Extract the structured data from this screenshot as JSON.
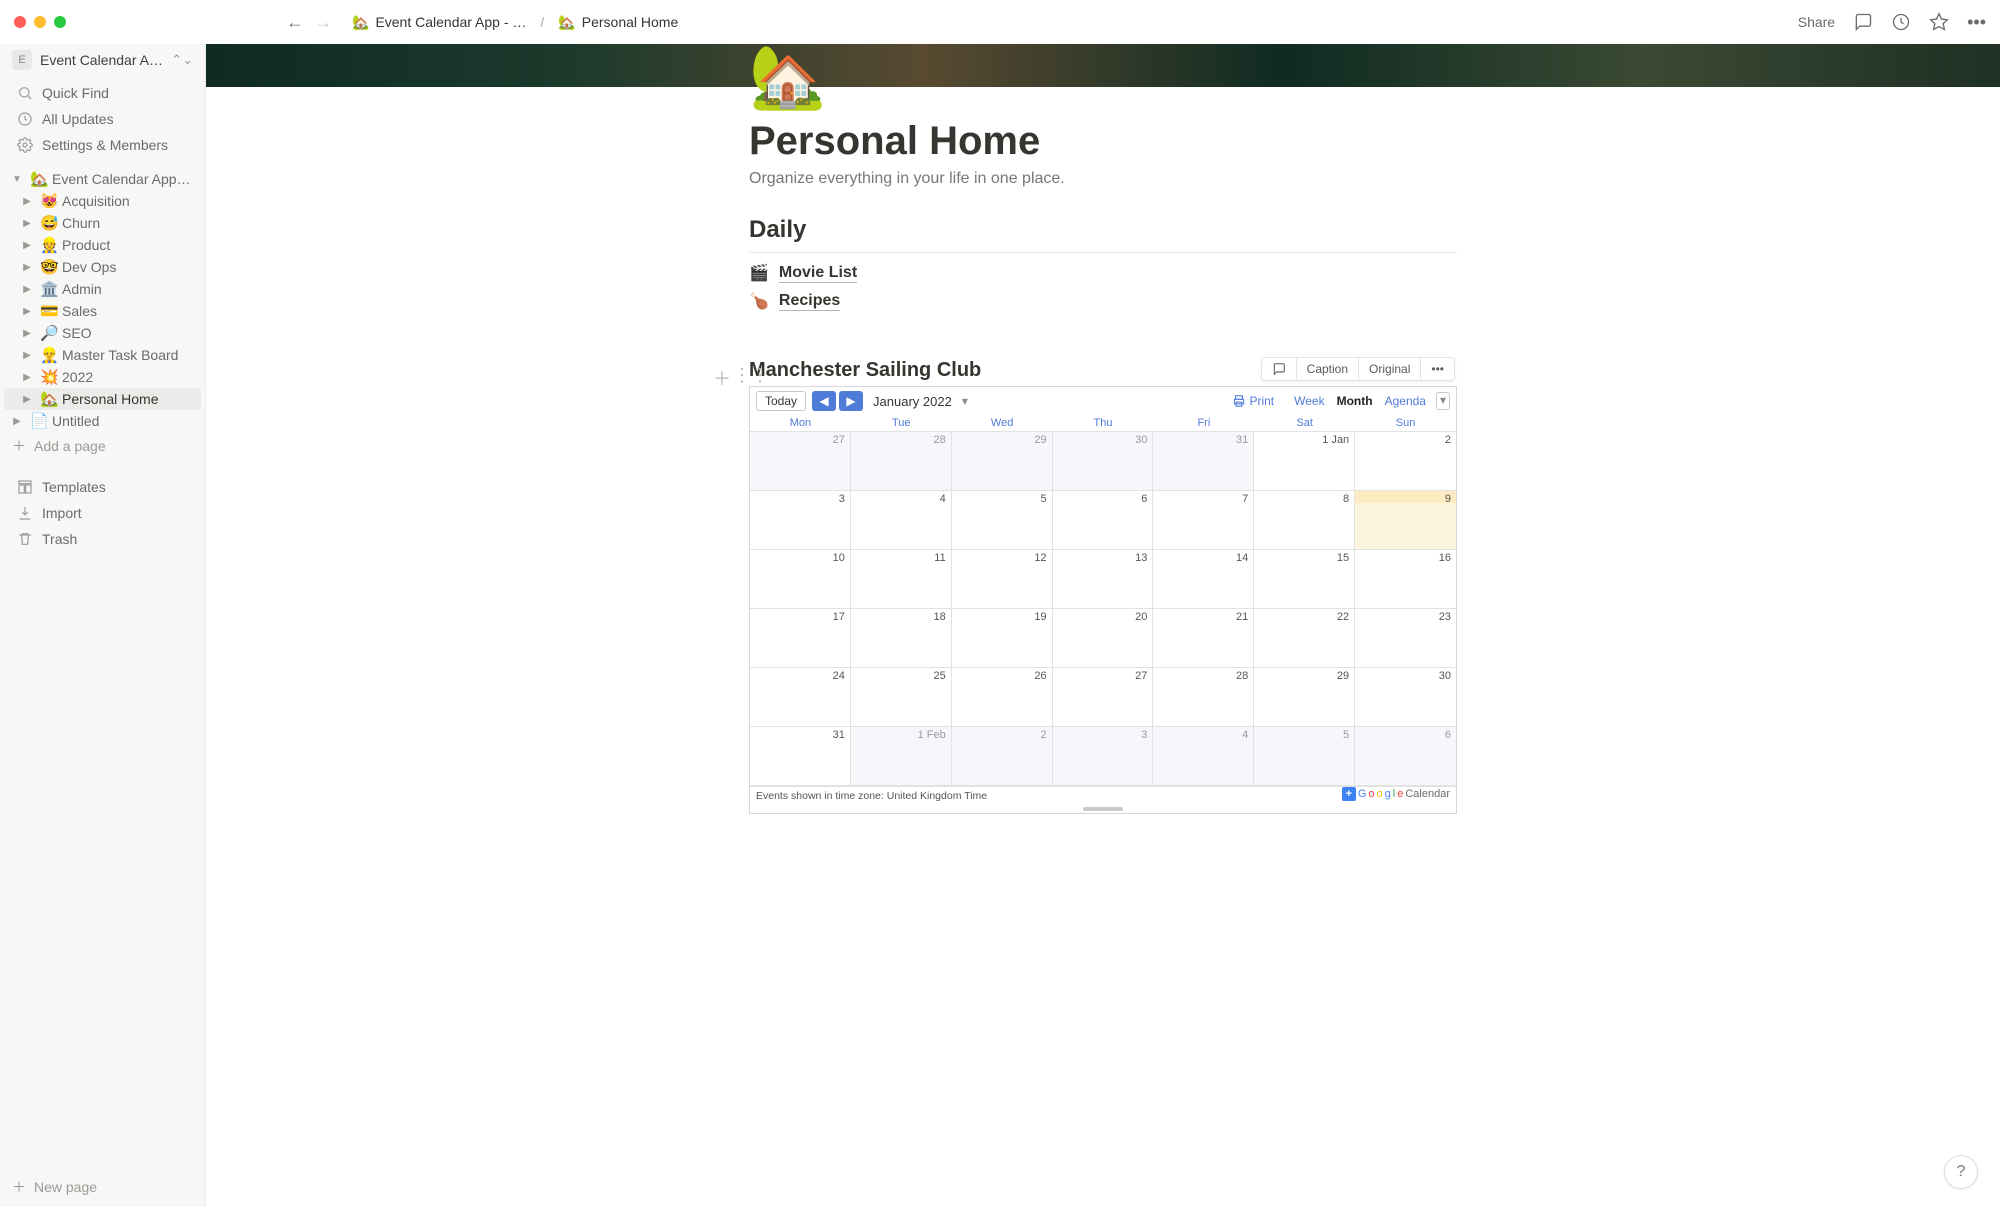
{
  "topbar": {
    "breadcrumb": [
      {
        "emoji": "🏡",
        "label": "Event Calendar App - …"
      },
      {
        "emoji": "🏡",
        "label": "Personal Home"
      }
    ],
    "share": "Share"
  },
  "sidebar": {
    "workspace_letter": "E",
    "workspace": "Event Calendar App",
    "nav": [
      {
        "icon": "search",
        "label": "Quick Find"
      },
      {
        "icon": "clock",
        "label": "All Updates"
      },
      {
        "icon": "gear",
        "label": "Settings & Members"
      }
    ],
    "tree_root": {
      "emoji": "🏡",
      "label": "Event Calendar App - …",
      "expanded": true
    },
    "tree_children": [
      {
        "emoji": "😻",
        "label": "Acquisition"
      },
      {
        "emoji": "😅",
        "label": "Churn"
      },
      {
        "emoji": "👷",
        "label": "Product"
      },
      {
        "emoji": "🤓",
        "label": "Dev Ops"
      },
      {
        "emoji": "🏛️",
        "label": "Admin"
      },
      {
        "emoji": "💳",
        "label": "Sales"
      },
      {
        "emoji": "🔎",
        "label": "SEO"
      },
      {
        "emoji": "👷‍♂️",
        "label": "Master Task Board"
      },
      {
        "emoji": "💥",
        "label": "2022"
      },
      {
        "emoji": "🏡",
        "label": "Personal Home",
        "active": true
      }
    ],
    "untitled": {
      "emoji": "📄",
      "label": "Untitled"
    },
    "add_page": "Add a page",
    "footer": [
      {
        "icon": "template",
        "label": "Templates"
      },
      {
        "icon": "import",
        "label": "Import"
      },
      {
        "icon": "trash",
        "label": "Trash"
      }
    ],
    "new_page": "New page"
  },
  "page": {
    "emoji": "🏡",
    "title": "Personal Home",
    "subtitle": "Organize everything in your life in one place.",
    "section": "Daily",
    "links": [
      {
        "emoji": "🎬",
        "label": "Movie List"
      },
      {
        "emoji": "🍗",
        "label": "Recipes"
      }
    ]
  },
  "embed": {
    "title": "Manchester Sailing Club",
    "toolbar": {
      "caption": "Caption",
      "original": "Original"
    },
    "today": "Today",
    "month_label": "January 2022",
    "print": "Print",
    "views": {
      "week": "Week",
      "month": "Month",
      "agenda": "Agenda"
    },
    "day_headers": [
      "Mon",
      "Tue",
      "Wed",
      "Thu",
      "Fri",
      "Sat",
      "Sun"
    ],
    "cells": [
      {
        "dn": "27",
        "cls": "out"
      },
      {
        "dn": "28",
        "cls": "out"
      },
      {
        "dn": "29",
        "cls": "out"
      },
      {
        "dn": "30",
        "cls": "out"
      },
      {
        "dn": "31",
        "cls": "out"
      },
      {
        "dn": "1 Jan",
        "cls": "cur"
      },
      {
        "dn": "2",
        "cls": "cur"
      },
      {
        "dn": "3",
        "cls": "cur"
      },
      {
        "dn": "4",
        "cls": "cur"
      },
      {
        "dn": "5",
        "cls": "cur"
      },
      {
        "dn": "6",
        "cls": "cur"
      },
      {
        "dn": "7",
        "cls": "cur"
      },
      {
        "dn": "8",
        "cls": "cur"
      },
      {
        "dn": "9",
        "cls": "today"
      },
      {
        "dn": "10",
        "cls": "cur"
      },
      {
        "dn": "11",
        "cls": "cur"
      },
      {
        "dn": "12",
        "cls": "cur"
      },
      {
        "dn": "13",
        "cls": "cur"
      },
      {
        "dn": "14",
        "cls": "cur"
      },
      {
        "dn": "15",
        "cls": "cur"
      },
      {
        "dn": "16",
        "cls": "cur"
      },
      {
        "dn": "17",
        "cls": "cur"
      },
      {
        "dn": "18",
        "cls": "cur"
      },
      {
        "dn": "19",
        "cls": "cur"
      },
      {
        "dn": "20",
        "cls": "cur"
      },
      {
        "dn": "21",
        "cls": "cur"
      },
      {
        "dn": "22",
        "cls": "cur"
      },
      {
        "dn": "23",
        "cls": "cur"
      },
      {
        "dn": "24",
        "cls": "cur"
      },
      {
        "dn": "25",
        "cls": "cur"
      },
      {
        "dn": "26",
        "cls": "cur"
      },
      {
        "dn": "27",
        "cls": "cur"
      },
      {
        "dn": "28",
        "cls": "cur"
      },
      {
        "dn": "29",
        "cls": "cur"
      },
      {
        "dn": "30",
        "cls": "cur"
      },
      {
        "dn": "31",
        "cls": "cur"
      },
      {
        "dn": "1 Feb",
        "cls": "out"
      },
      {
        "dn": "2",
        "cls": "out"
      },
      {
        "dn": "3",
        "cls": "out"
      },
      {
        "dn": "4",
        "cls": "out"
      },
      {
        "dn": "5",
        "cls": "out"
      },
      {
        "dn": "6",
        "cls": "out"
      }
    ],
    "tz": "Events shown in time zone: United Kingdom Time",
    "gcal_word": "Calendar"
  }
}
